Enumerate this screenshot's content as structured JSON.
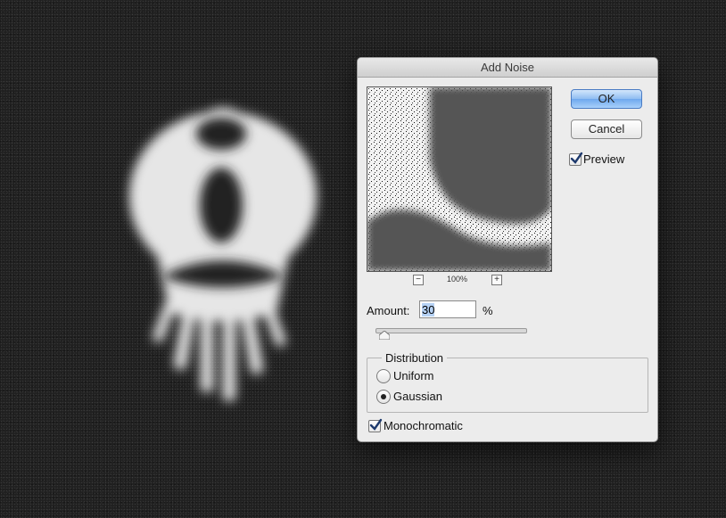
{
  "dialog": {
    "title": "Add Noise",
    "ok_label": "OK",
    "cancel_label": "Cancel",
    "preview_label": "Preview",
    "preview_checked": true,
    "zoom_level": "100%",
    "zoom_out_symbol": "−",
    "zoom_in_symbol": "+",
    "amount_label": "Amount:",
    "amount_value": "30",
    "amount_unit": "%",
    "slider_position": 0.08,
    "distribution": {
      "title": "Distribution",
      "options": [
        "Uniform",
        "Gaussian"
      ],
      "selected": "Gaussian"
    },
    "monochromatic_label": "Monochromatic",
    "monochromatic_checked": true
  },
  "icons": {
    "check": "checkmark-icon",
    "zoom_out": "minus-icon",
    "zoom_in": "plus-icon"
  },
  "colors": {
    "default_button": "#6fa8ee",
    "dialog_bg": "#ececec",
    "canvas_bg": "#202020"
  }
}
